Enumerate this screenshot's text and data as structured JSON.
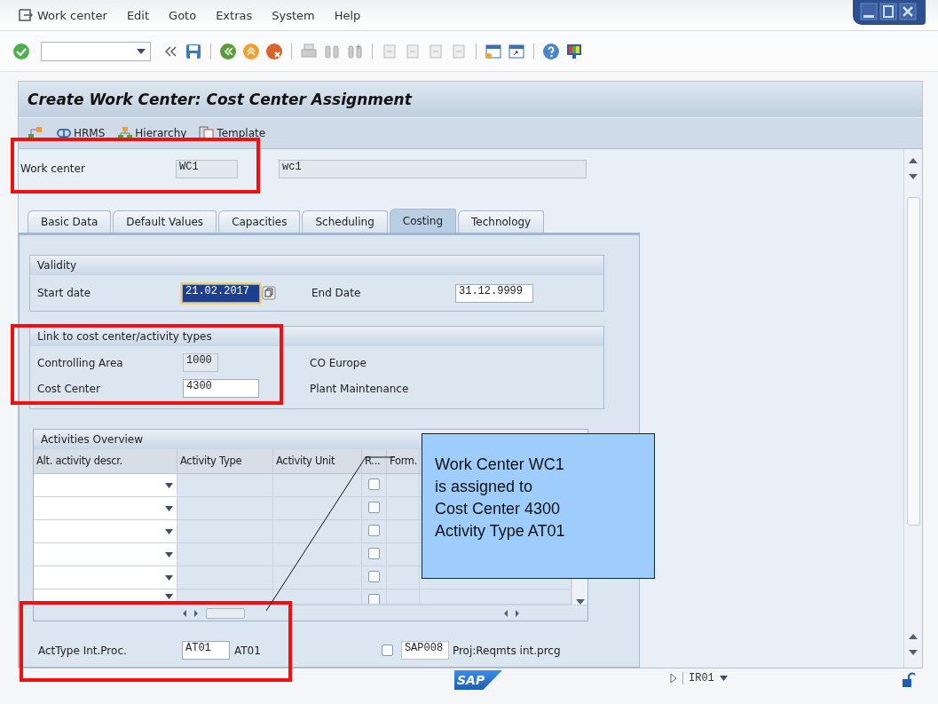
{
  "menu_bar": {
    "items": [
      "Work center",
      "Edit",
      "Goto",
      "Extras",
      "System",
      "Help"
    ]
  },
  "screen": {
    "title": "Create Work Center: Cost Center Assignment",
    "app_toolbar": [
      {
        "label": "HRMS"
      },
      {
        "label": "Hierarchy"
      },
      {
        "label": "Template"
      }
    ],
    "header": {
      "label": "Work center",
      "value": "WC1",
      "editable": false,
      "description": "wc1"
    },
    "tabs": [
      {
        "label": "Basic Data",
        "selected": false
      },
      {
        "label": "Default Values",
        "selected": false
      },
      {
        "label": "Capacities",
        "selected": false
      },
      {
        "label": "Scheduling",
        "selected": false
      },
      {
        "label": "Costing",
        "selected": true
      },
      {
        "label": "Technology",
        "selected": false
      }
    ],
    "validity": {
      "title": "Validity",
      "fields": [
        {
          "label": "Start date",
          "value": "21.02.2017",
          "editable": true,
          "focused": true
        },
        {
          "label": "End Date",
          "value": "31.12.9999",
          "editable": true,
          "focused": false
        }
      ]
    },
    "link": {
      "title": "Link to cost center/activity types",
      "fields": [
        {
          "label": "Controlling Area",
          "value": "1000",
          "editable": false,
          "description": "CO Europe"
        },
        {
          "label": "Cost Center",
          "value": "4300",
          "editable": true,
          "description": "Plant Maintenance"
        }
      ]
    },
    "activities": {
      "title": "Activities Overview",
      "columns": [
        "Alt. activity descr.",
        "Activity Type",
        "Activity Unit",
        "R...",
        "Form."
      ],
      "rows": [
        {
          "checked": false
        },
        {
          "checked": false
        },
        {
          "checked": false
        },
        {
          "checked": false
        },
        {
          "checked": false
        },
        {
          "checked": false
        }
      ]
    },
    "bottom": {
      "label": "ActType Int.Proc.",
      "value": "AT01",
      "description": "AT01",
      "checked": false,
      "code": "SAP008",
      "code_text": "Proj:Reqmts int.prcg"
    }
  },
  "callout": {
    "lines": [
      "Work Center WC1",
      "is assigned to",
      "Cost Center 4300",
      "Activity Type AT01"
    ]
  },
  "status_bar": {
    "logo": "SAP",
    "system": "IR01"
  }
}
